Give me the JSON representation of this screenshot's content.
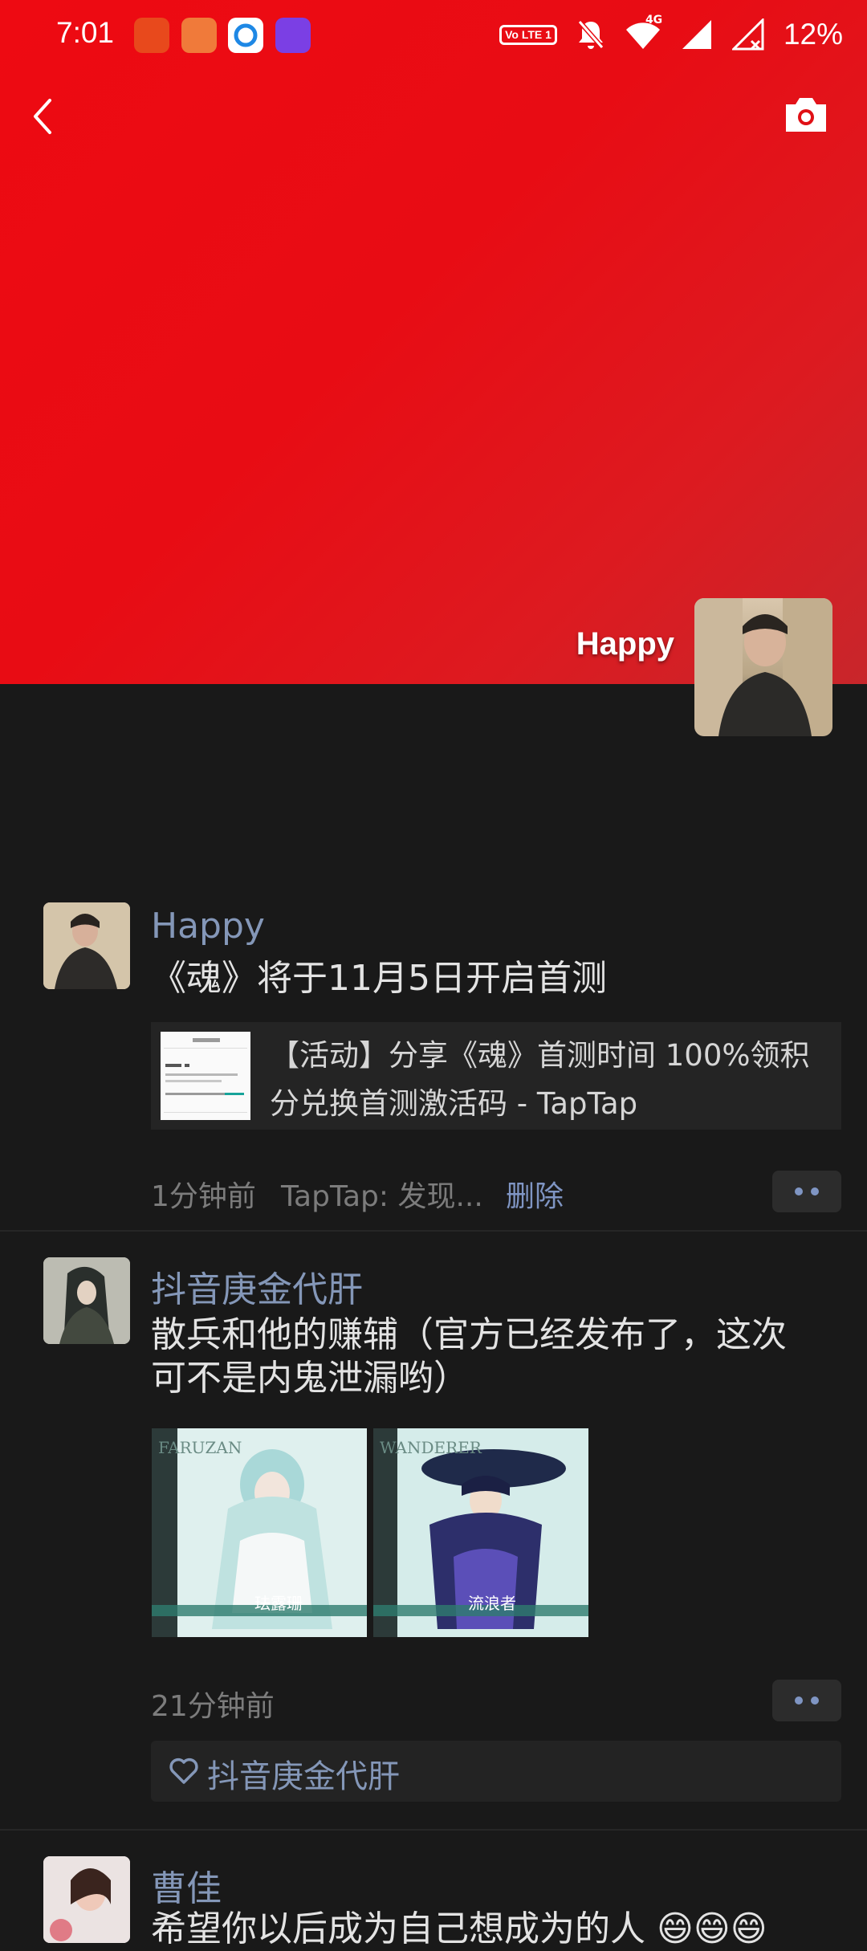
{
  "status_bar": {
    "time": "7:01",
    "network_label": "4G",
    "volte_label": "Vo LTE 1",
    "battery": "12%"
  },
  "header": {
    "back_icon": "chevron-left-icon",
    "camera_icon": "camera-icon",
    "cover_color": "#e80c14"
  },
  "profile": {
    "name": "Happy"
  },
  "posts": [
    {
      "user": "Happy",
      "text": "《魂》将于11月5日开启首测",
      "link_title": "【活动】分享《魂》首测时间 100%领积分兑换首测激活码 - TapTap",
      "time": "1分钟前",
      "source": "TapTap: 发现...",
      "delete_label": "删除"
    },
    {
      "user": "抖音庚金代肝",
      "text": "散兵和他的赚辅（官方已经发布了，这次可不是内鬼泄漏哟）",
      "images": [
        {
          "top_label": "FARUZAN",
          "name_label": "珐露珊"
        },
        {
          "top_label": "WANDERER",
          "name_label": "流浪者"
        }
      ],
      "time": "21分钟前",
      "like_name": "抖音庚金代肝"
    },
    {
      "user": "曹佳",
      "text": "希望你以后成为自己想成为的人 😄😄😄"
    }
  ]
}
